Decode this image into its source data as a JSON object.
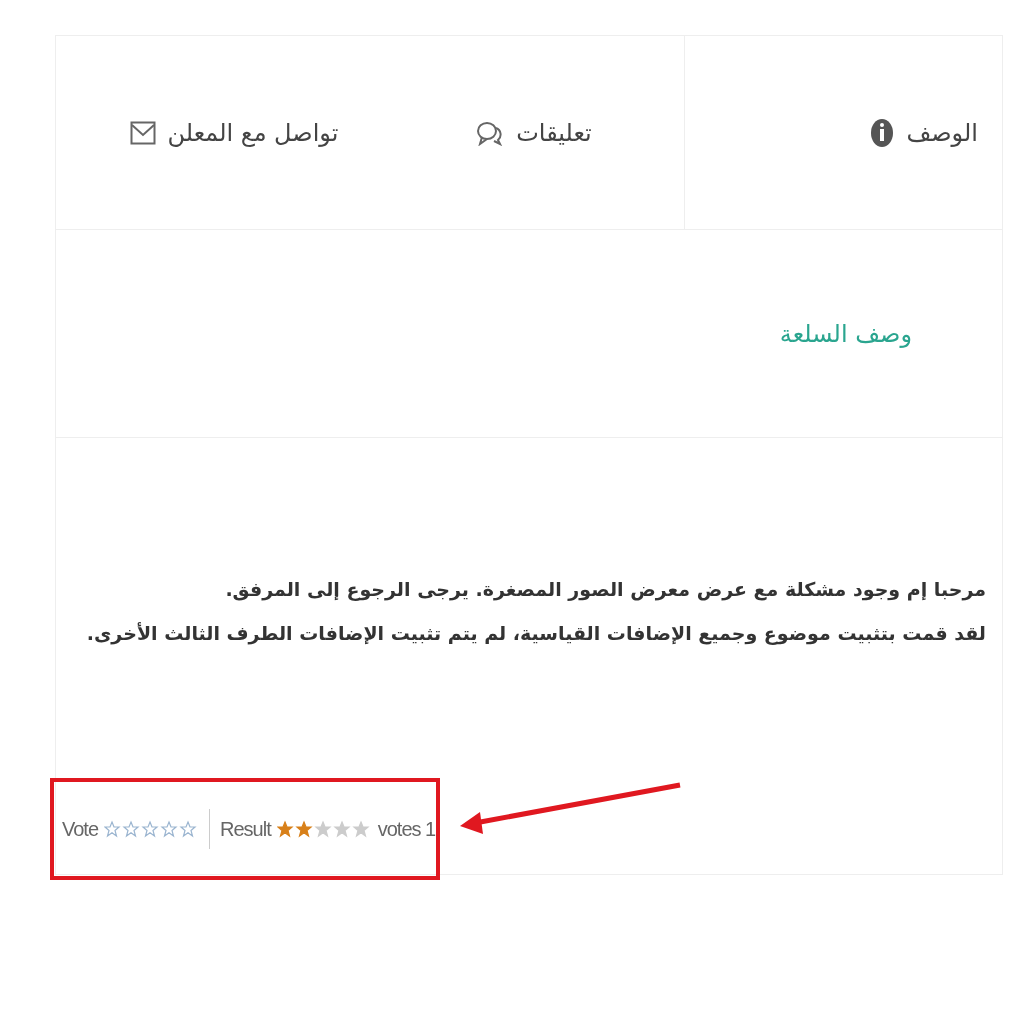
{
  "tabs": [
    {
      "label": "الوصف",
      "kind": "info",
      "selected": true
    },
    {
      "label": "تعليقات",
      "kind": "comments",
      "selected": false
    },
    {
      "label": "تواصل مع المعلن",
      "kind": "mail",
      "selected": false
    }
  ],
  "section_title": "وصف السلعة",
  "description": [
    "مرحبا إم وجود مشكلة مع عرض معرض الصور المصغرة. يرجى الرجوع إلى المرفق.",
    "لقد قمت بتثبيت موضوع وجميع الإضافات القياسية، لم يتم تثبيت الإضافات الطرف الثالث الأخرى."
  ],
  "rating": {
    "vote_label": "Vote",
    "result_label": "Result",
    "stars": 2,
    "votes_text": "votes 1"
  }
}
